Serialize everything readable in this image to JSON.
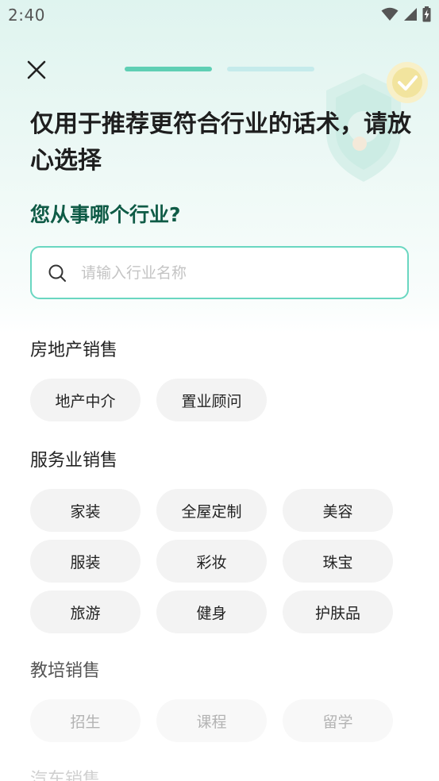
{
  "status_bar": {
    "time": "2:40"
  },
  "header": {
    "progress_steps": [
      {
        "state": "active"
      },
      {
        "state": "inactive"
      }
    ]
  },
  "colors": {
    "accent": "#5fcfb4",
    "question": "#0f5b46",
    "chip_bg": "#f3f3f3"
  },
  "title": "仅用于推荐更符合行业的话术，请放心选择",
  "question": "您从事哪个行业?",
  "search": {
    "placeholder": "请输入行业名称",
    "value": ""
  },
  "categories": [
    {
      "title": "房地产销售",
      "items": [
        "地产中介",
        "置业顾问"
      ]
    },
    {
      "title": "服务业销售",
      "items": [
        "家装",
        "全屋定制",
        "美容",
        "服装",
        "彩妆",
        "珠宝",
        "旅游",
        "健身",
        "护肤品"
      ]
    },
    {
      "title": "教培销售",
      "items": [
        "招生",
        "课程",
        "留学"
      ]
    },
    {
      "title": "汽车销售",
      "items": []
    }
  ]
}
